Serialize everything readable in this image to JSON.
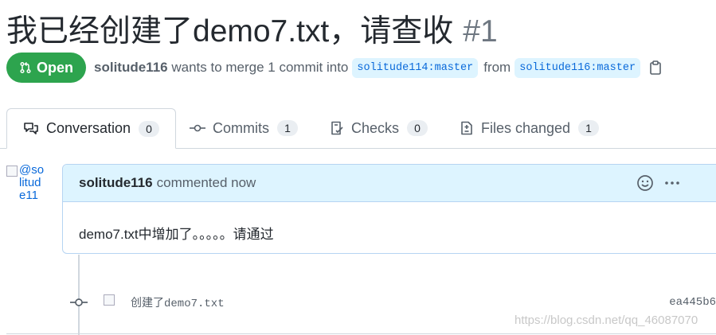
{
  "pr": {
    "title": "我已经创建了demo7.txt，请查收",
    "number": "#1",
    "state": "Open",
    "author": "solitude116",
    "summary_middle": "wants to merge 1 commit into",
    "base_branch": "solitude114:master",
    "from_word": "from",
    "head_branch": "solitude116:master"
  },
  "tabs": [
    {
      "label": "Conversation",
      "count": "0"
    },
    {
      "label": "Commits",
      "count": "1"
    },
    {
      "label": "Checks",
      "count": "0"
    },
    {
      "label": "Files changed",
      "count": "1"
    }
  ],
  "avatar_alt": "@solitude116",
  "comment": {
    "author": "solitude116",
    "meta": "commented now",
    "body": "demo7.txt中增加了。。。。。请通过"
  },
  "commit": {
    "message": "创建了demo7.txt",
    "sha": "ea445b6"
  },
  "watermark": "https://blog.csdn.net/qq_46087070",
  "colors": {
    "open_green": "#2da44e",
    "link_blue": "#0969da",
    "branch_bg": "#ddf4ff",
    "comment_header_bg": "#ddf4ff"
  }
}
